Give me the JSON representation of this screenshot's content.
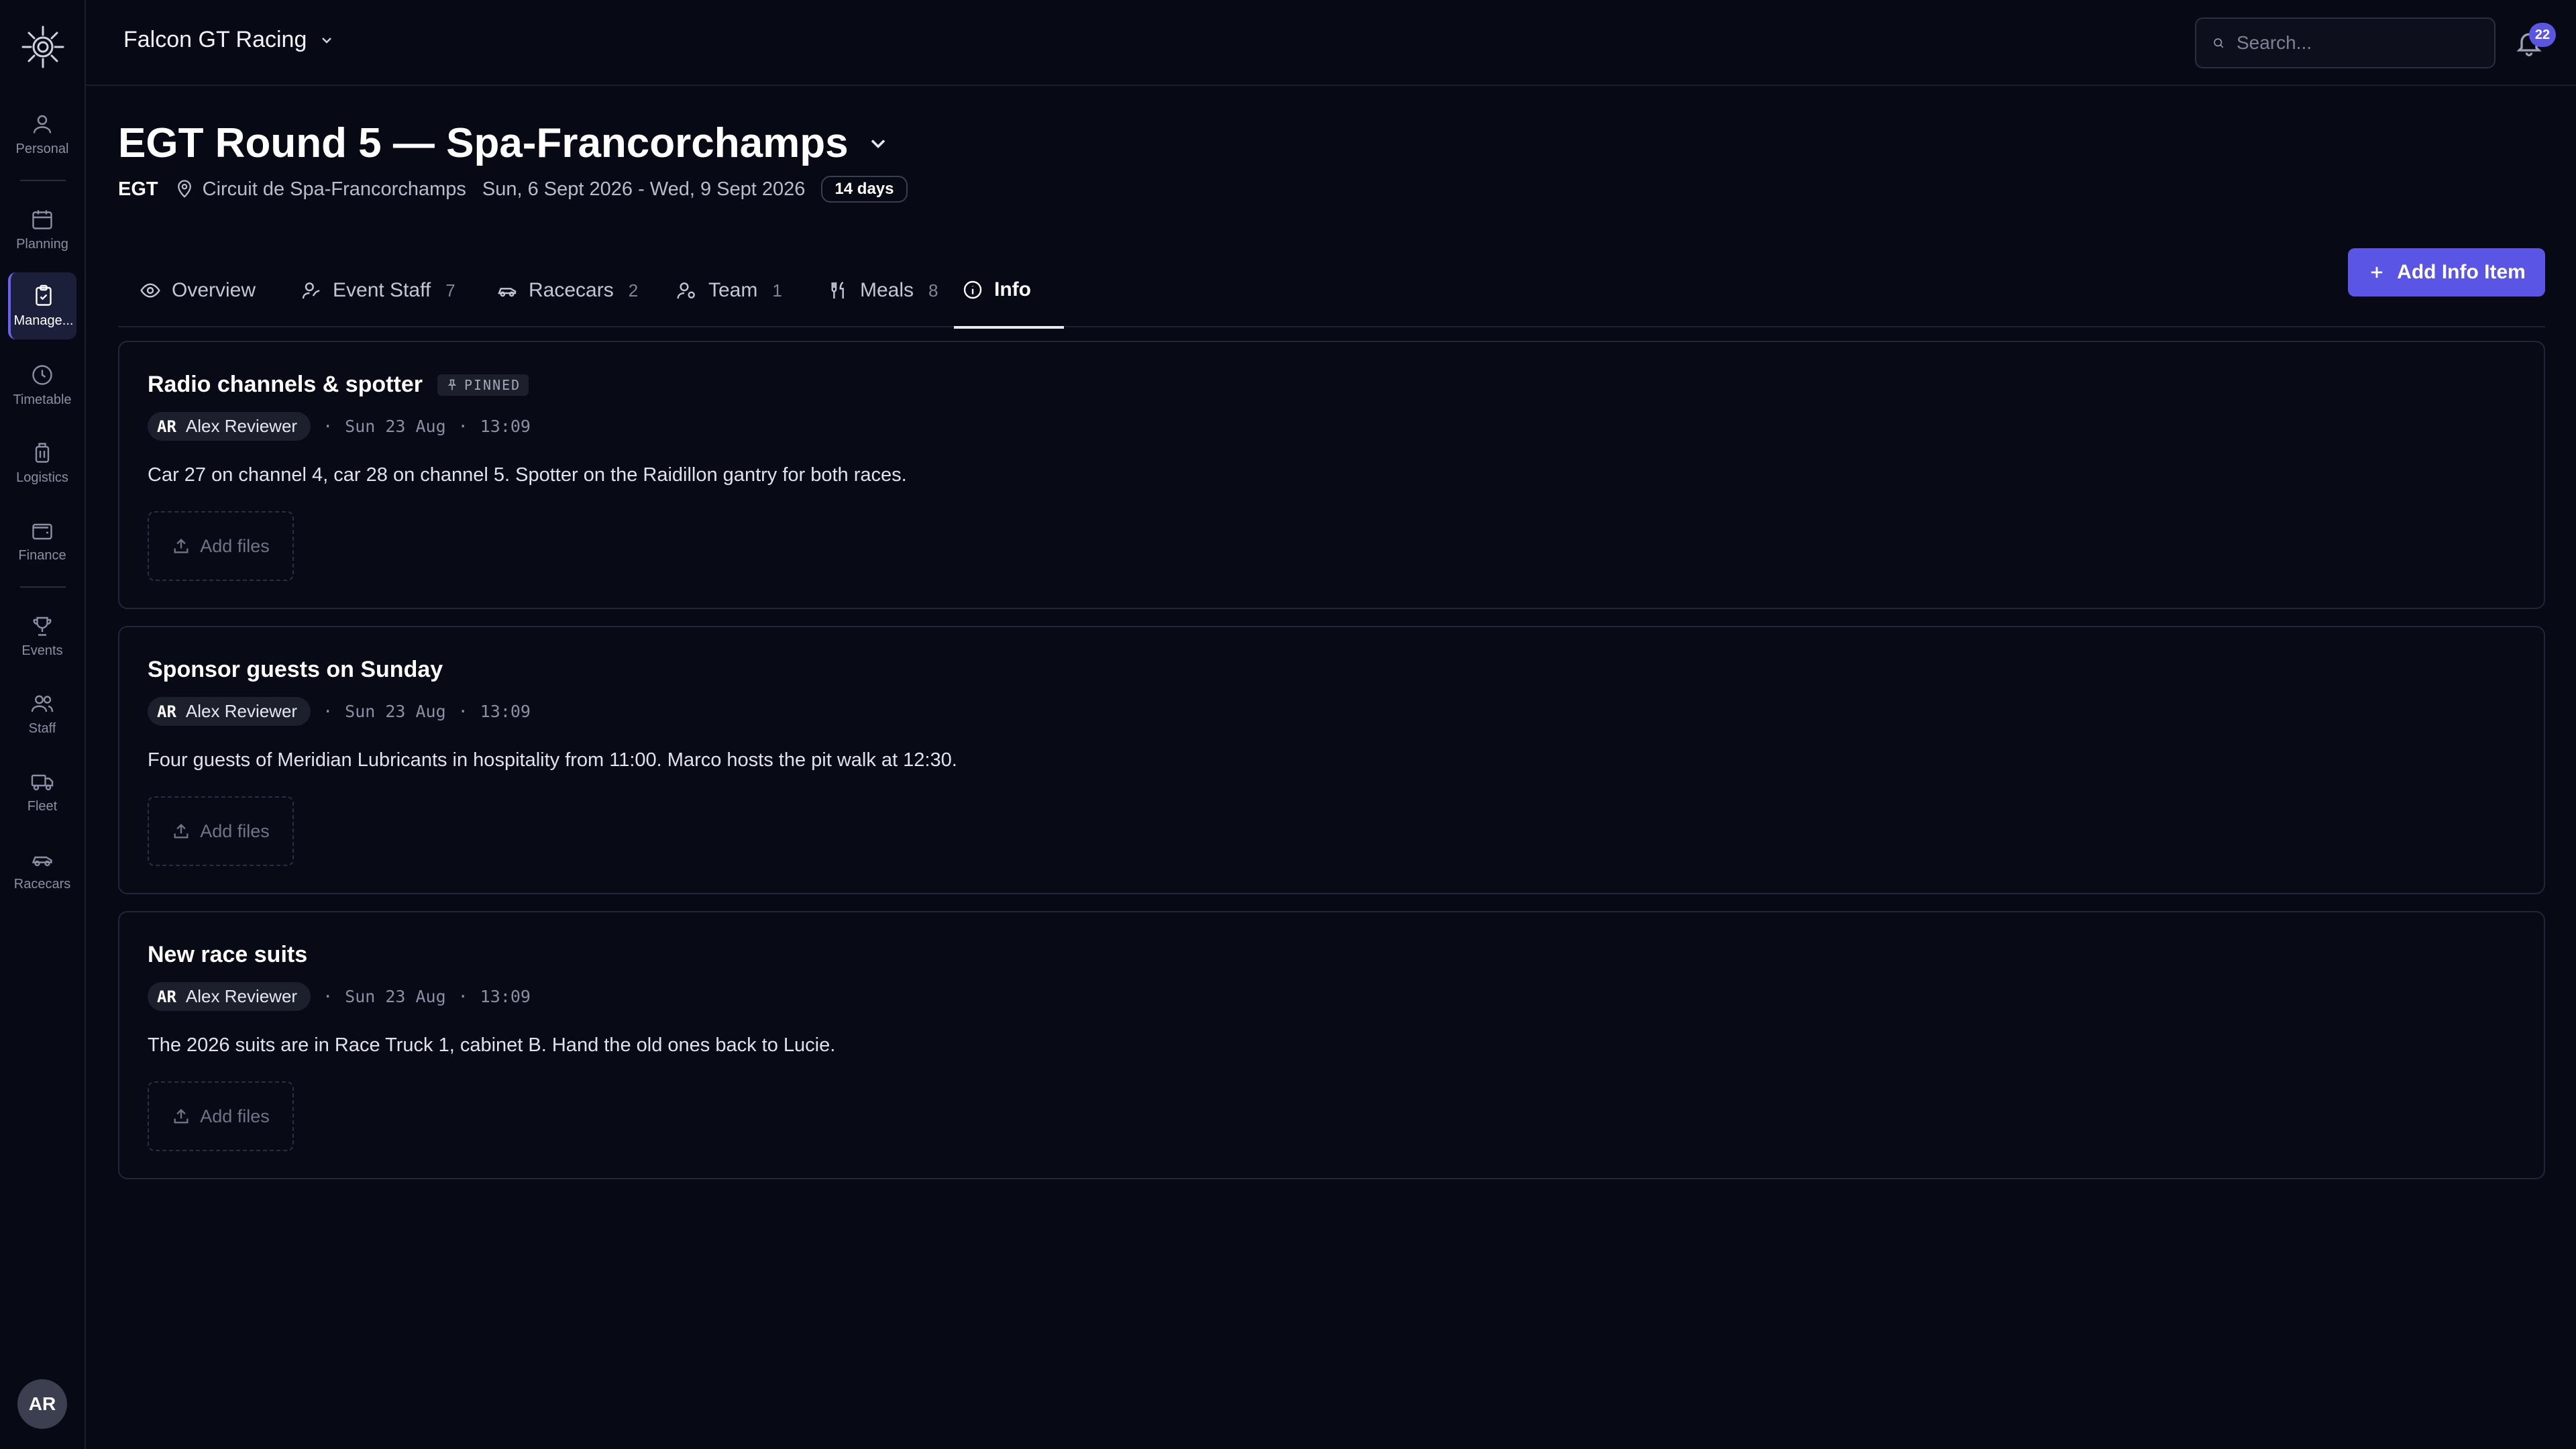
{
  "sidebar": {
    "items": [
      {
        "label": "Personal",
        "icon": "user-icon"
      },
      {
        "label": "Planning",
        "icon": "calendar-icon"
      },
      {
        "label": "Manage...",
        "icon": "clipboard-icon"
      },
      {
        "label": "Timetable",
        "icon": "clock-icon"
      },
      {
        "label": "Logistics",
        "icon": "luggage-icon"
      },
      {
        "label": "Finance",
        "icon": "wallet-icon"
      },
      {
        "label": "Events",
        "icon": "trophy-icon"
      },
      {
        "label": "Staff",
        "icon": "users-icon"
      },
      {
        "label": "Fleet",
        "icon": "truck-icon"
      },
      {
        "label": "Racecars",
        "icon": "car-icon"
      }
    ],
    "user_initials": "AR"
  },
  "topbar": {
    "org_name": "Falcon GT Racing",
    "search_placeholder": "Search...",
    "notification_count": "22"
  },
  "event": {
    "title": "EGT Round 5 — Spa-Francorchamps",
    "series": "EGT",
    "location": "Circuit de Spa-Francorchamps",
    "dates": "Sun, 6 Sept 2026 - Wed, 9 Sept 2026",
    "duration": "14 days"
  },
  "tabs": [
    {
      "label": "Overview",
      "count": ""
    },
    {
      "label": "Event Staff",
      "count": "7"
    },
    {
      "label": "Racecars",
      "count": "2"
    },
    {
      "label": "Team",
      "count": "1"
    },
    {
      "label": "Meals",
      "count": "8"
    },
    {
      "label": "Info",
      "count": ""
    }
  ],
  "actions": {
    "add_info": "Add Info Item"
  },
  "info_items": [
    {
      "title": "Radio channels & spotter",
      "pinned": "PINNED",
      "author_initials": "AR",
      "author": "Alex Reviewer",
      "date": "Sun 23 Aug",
      "time": "13:09",
      "body": "Car 27 on channel 4, car 28 on channel 5. Spotter on the Raidillon gantry for both races.",
      "add_files": "Add files"
    },
    {
      "title": "Sponsor guests on Sunday",
      "author_initials": "AR",
      "author": "Alex Reviewer",
      "date": "Sun 23 Aug",
      "time": "13:09",
      "body": "Four guests of Meridian Lubricants in hospitality from 11:00. Marco hosts the pit walk at 12:30.",
      "add_files": "Add files"
    },
    {
      "title": "New race suits",
      "author_initials": "AR",
      "author": "Alex Reviewer",
      "date": "Sun 23 Aug",
      "time": "13:09",
      "body": "The 2026 suits are in Race Truck 1, cabinet B. Hand the old ones back to Lucie.",
      "add_files": "Add files"
    }
  ],
  "colors": {
    "accent": "#5b55e6",
    "background": "#070914",
    "border": "#22263a"
  }
}
